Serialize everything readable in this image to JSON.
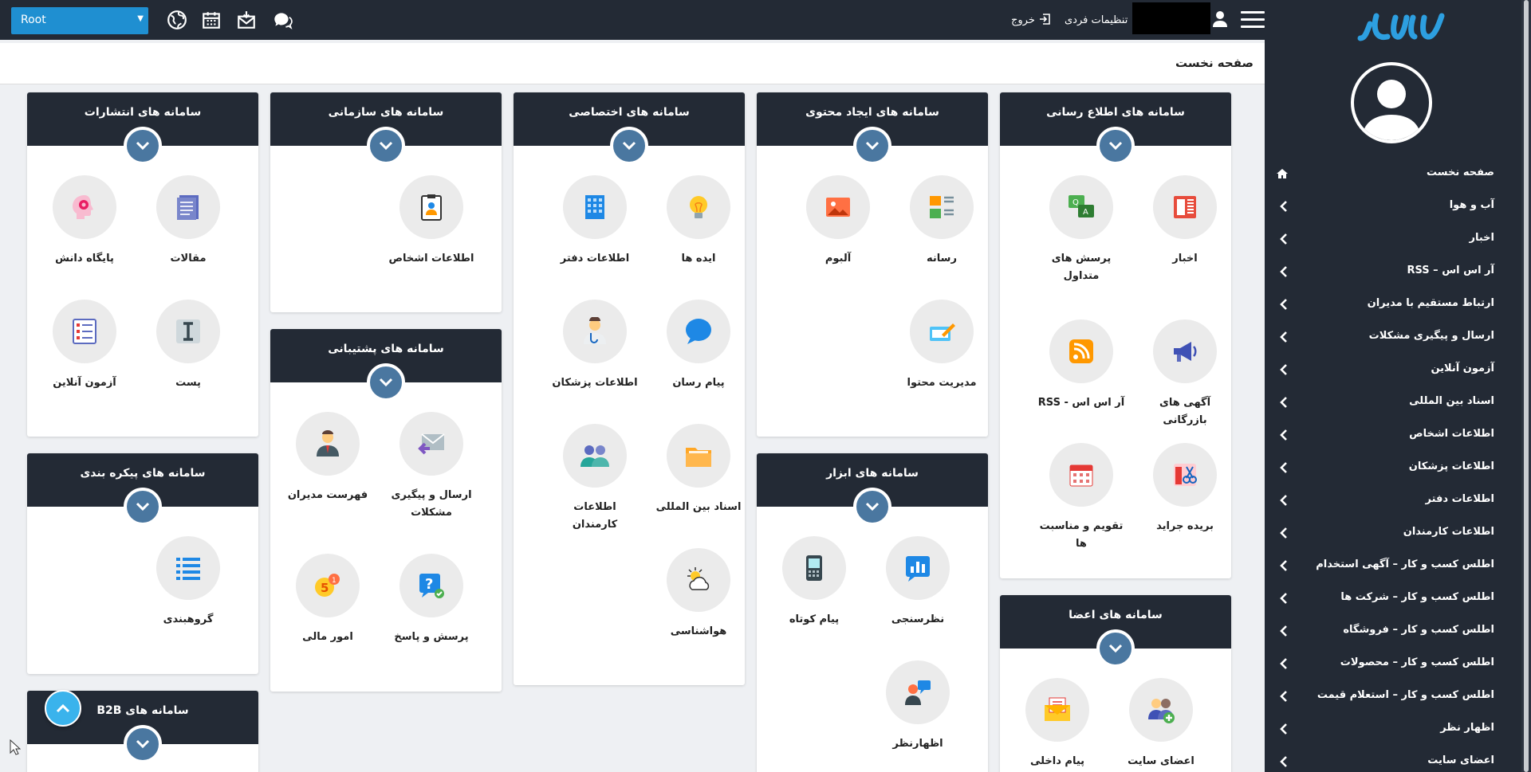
{
  "topbar": {
    "root_select": "Root",
    "logout_label": "خروج",
    "settings_label": "تنظیمات فردی",
    "icons": [
      "globe-icon",
      "calendar-icon",
      "mail-icon",
      "chat-icon"
    ]
  },
  "breadcrumb": {
    "title": "صفحه نخست"
  },
  "sidebar": {
    "logo_text": "سانا",
    "items": [
      {
        "label": "صفحه نخست",
        "icon": "home-icon"
      },
      {
        "label": "آب و هوا"
      },
      {
        "label": "اخبار"
      },
      {
        "label": "آر اس اس – RSS"
      },
      {
        "label": "ارتباط مستقیم با مدیران"
      },
      {
        "label": "ارسال و پیگیری مشکلات"
      },
      {
        "label": "آزمون آنلاین"
      },
      {
        "label": "اسناد بین المللی"
      },
      {
        "label": "اطلاعات اشخاص"
      },
      {
        "label": "اطلاعات پزشکان"
      },
      {
        "label": "اطلاعات دفتر"
      },
      {
        "label": "اطلاعات کارمندان"
      },
      {
        "label": "اطلس کسب و کار – آگهی استخدام"
      },
      {
        "label": "اطلس کسب و کار – شرکت ها"
      },
      {
        "label": "اطلس کسب و کار – فروشگاه"
      },
      {
        "label": "اطلس کسب و کار – محصولات"
      },
      {
        "label": "اطلس کسب و کار – استعلام قیمت"
      },
      {
        "label": "اظهار نظر"
      },
      {
        "label": "اعضای سایت"
      }
    ]
  },
  "cards": {
    "info": {
      "title": "سامانه های اطلاع رسانی",
      "items": [
        "اخبار",
        "پرسش های متداول",
        "آگهی های بازرگانی",
        "آر اس اس - RSS",
        "بریده جراید",
        "تقویم و مناسبت ها"
      ]
    },
    "content": {
      "title": "سامانه های ایجاد محتوی",
      "items": [
        "رسانه",
        "آلبوم",
        "مدیریت محتوا"
      ]
    },
    "special": {
      "title": "سامانه های اختصاصی",
      "items": [
        "ایده ها",
        "اطلاعات دفتر",
        "پیام رسان",
        "اطلاعات پزشکان",
        "اسناد بین المللی",
        "اطلاعات کارمندان",
        "هواشناسی"
      ]
    },
    "org": {
      "title": "سامانه های سازمانی",
      "items": [
        "اطلاعات اشخاص"
      ]
    },
    "pub": {
      "title": "سامانه های انتشارات",
      "items": [
        "مقالات",
        "پایگاه دانش",
        "پست",
        "آزمون آنلاین"
      ]
    },
    "support": {
      "title": "سامانه های پشتیبانی",
      "items": [
        "ارسال و پیگیری مشکلات",
        "فهرست مدیران",
        "پرسش و پاسخ",
        "امور مالی"
      ]
    },
    "tools": {
      "title": "سامانه های ابزار",
      "items": [
        "نظرسنجی",
        "پیام کوتاه",
        "اظهارنظر"
      ]
    },
    "members": {
      "title": "سامانه های اعضا",
      "items": [
        "اعضای سایت",
        "پیام داخلی"
      ]
    },
    "config": {
      "title": "سامانه های پیکره بندی",
      "items": [
        "گروهبندی"
      ]
    },
    "b2b": {
      "title": "سامانه های B2B"
    }
  },
  "colors": {
    "header": "#232a35",
    "accent": "#1f8fd1",
    "toggle": "#4a77a0",
    "fab": "#3ab3ec"
  }
}
